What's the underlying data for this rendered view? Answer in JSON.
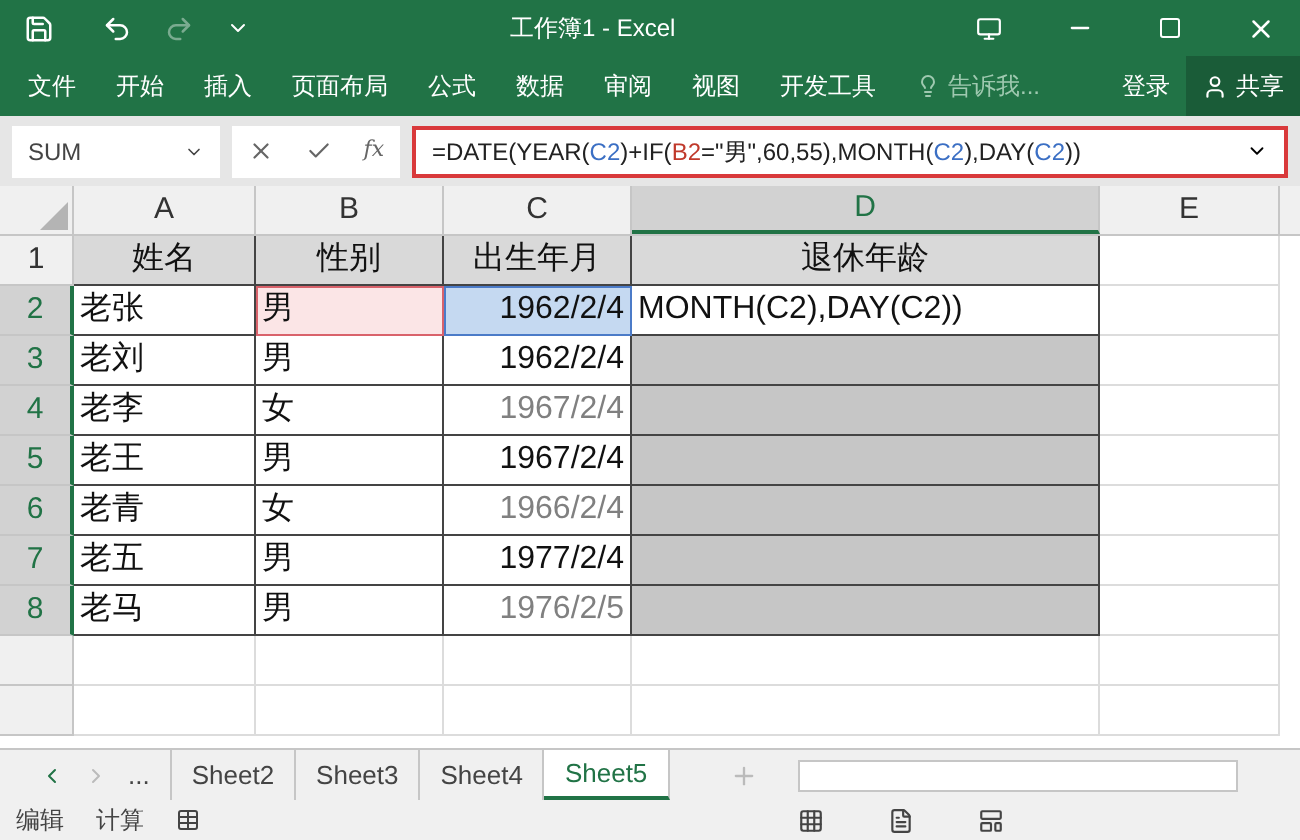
{
  "window": {
    "title": "工作簿1 - Excel"
  },
  "ribbon_tabs": [
    {
      "label": "文件"
    },
    {
      "label": "开始"
    },
    {
      "label": "插入"
    },
    {
      "label": "页面布局"
    },
    {
      "label": "公式"
    },
    {
      "label": "数据"
    },
    {
      "label": "审阅"
    },
    {
      "label": "视图"
    },
    {
      "label": "开发工具"
    }
  ],
  "tell_me": {
    "placeholder": "告诉我..."
  },
  "sign_in": "登录",
  "share": "共享",
  "name_box": "SUM",
  "function_button": "fx",
  "formula": [
    {
      "text": "=DATE(YEAR(",
      "color": "#222222"
    },
    {
      "text": "C2",
      "color": "#3b6fc4"
    },
    {
      "text": ")+IF(",
      "color": "#222222"
    },
    {
      "text": "B2",
      "color": "#c0392b"
    },
    {
      "text": "=\"男\",60,55),MONTH(",
      "color": "#222222"
    },
    {
      "text": "C2",
      "color": "#3b6fc4"
    },
    {
      "text": "),DAY(",
      "color": "#222222"
    },
    {
      "text": "C2",
      "color": "#3b6fc4"
    },
    {
      "text": "))",
      "color": "#222222"
    }
  ],
  "columns": [
    {
      "label": "A",
      "selected": false
    },
    {
      "label": "B",
      "selected": false
    },
    {
      "label": "C",
      "selected": false
    },
    {
      "label": "D",
      "selected": true
    },
    {
      "label": "E",
      "selected": false
    }
  ],
  "header_row": {
    "number": "1",
    "cells": [
      "姓名",
      "性别",
      "出生年月",
      "退休年龄"
    ]
  },
  "rows": [
    {
      "number": "2",
      "selected": true,
      "cells": [
        "老张",
        "男",
        "1962/2/4",
        "MONTH(C2),DAY(C2))"
      ],
      "faded": false
    },
    {
      "number": "3",
      "selected": true,
      "cells": [
        "老刘",
        "男",
        "1962/2/4",
        ""
      ],
      "faded": false
    },
    {
      "number": "4",
      "selected": true,
      "cells": [
        "老李",
        "女",
        "1967/2/4",
        ""
      ],
      "faded": true
    },
    {
      "number": "5",
      "selected": true,
      "cells": [
        "老王",
        "男",
        "1967/2/4",
        ""
      ],
      "faded": false
    },
    {
      "number": "6",
      "selected": true,
      "cells": [
        "老青",
        "女",
        "1966/2/4",
        ""
      ],
      "faded": true
    },
    {
      "number": "7",
      "selected": true,
      "cells": [
        "老五",
        "男",
        "1977/2/4",
        ""
      ],
      "faded": false
    },
    {
      "number": "8",
      "selected": true,
      "cells": [
        "老马",
        "男",
        "1976/2/5",
        ""
      ],
      "faded": true
    }
  ],
  "sheet_tabs": [
    {
      "label": "...",
      "selected": false
    },
    {
      "label": "Sheet2",
      "selected": false
    },
    {
      "label": "Sheet3",
      "selected": false
    },
    {
      "label": "Sheet4",
      "selected": false
    },
    {
      "label": "Sheet5",
      "selected": true
    }
  ],
  "status_bar": [
    "编辑",
    "计算"
  ]
}
